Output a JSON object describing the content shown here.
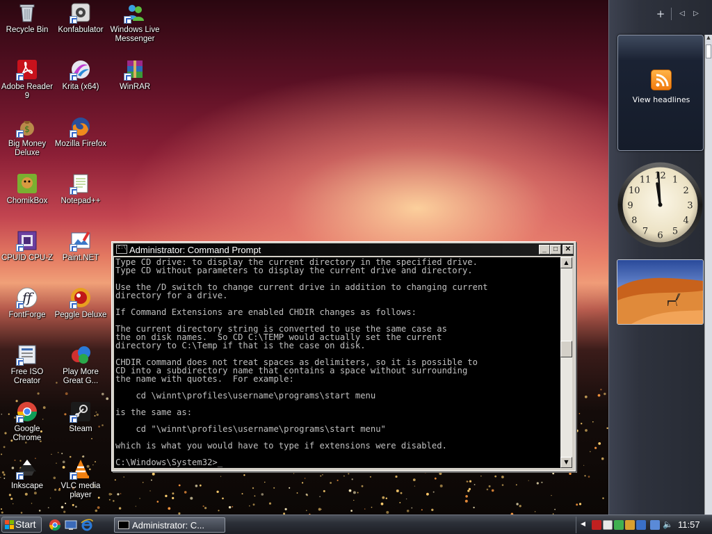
{
  "desktop": {
    "icons": [
      {
        "label": "Recycle Bin"
      },
      {
        "label": "Konfabulator"
      },
      {
        "label": "Windows Live Messenger"
      },
      {
        "label": "Adobe Reader 9"
      },
      {
        "label": "Krita (x64)"
      },
      {
        "label": "WinRAR"
      },
      {
        "label": "Big Money Deluxe"
      },
      {
        "label": "Mozilla Firefox"
      },
      {
        "label": "ChomikBox"
      },
      {
        "label": "Notepad++"
      },
      {
        "label": "CPUID CPU-Z"
      },
      {
        "label": "Paint.NET"
      },
      {
        "label": "FontForge"
      },
      {
        "label": "Peggle Deluxe"
      },
      {
        "label": "Free ISO Creator"
      },
      {
        "label": "Play More Great G..."
      },
      {
        "label": "Google Chrome"
      },
      {
        "label": "Steam"
      },
      {
        "label": "Inkscape"
      },
      {
        "label": "VLC media player"
      }
    ]
  },
  "sidebar": {
    "add_icon": "+",
    "prev_icon": "◁",
    "next_icon": "▷",
    "feeds_label": "View headlines",
    "clock_numbers": [
      "12",
      "1",
      "2",
      "3",
      "4",
      "5",
      "6",
      "7",
      "8",
      "9",
      "10",
      "11"
    ]
  },
  "cmd": {
    "title": "Administrator: Command Prompt",
    "minimize": "_",
    "maximize": "□",
    "close": "✕",
    "lines": [
      "Type CD drive: to display the current directory in the specified drive.",
      "Type CD without parameters to display the current drive and directory.",
      "",
      "Use the /D switch to change current drive in addition to changing current",
      "directory for a drive.",
      "",
      "If Command Extensions are enabled CHDIR changes as follows:",
      "",
      "The current directory string is converted to use the same case as",
      "the on disk names.  So CD C:\\TEMP would actually set the current",
      "directory to C:\\Temp if that is the case on disk.",
      "",
      "CHDIR command does not treat spaces as delimiters, so it is possible to",
      "CD into a subdirectory name that contains a space without surrounding",
      "the name with quotes.  For example:",
      "",
      "    cd \\winnt\\profiles\\username\\programs\\start menu",
      "",
      "is the same as:",
      "",
      "    cd \"\\winnt\\profiles\\username\\programs\\start menu\"",
      "",
      "which is what you would have to type if extensions were disabled.",
      "",
      "C:\\Windows\\System32>_"
    ]
  },
  "taskbar": {
    "start_label": "Start",
    "task_label": "Administrator: C...",
    "time": "11:57",
    "colors": {
      "accent": "#2c3038"
    }
  }
}
